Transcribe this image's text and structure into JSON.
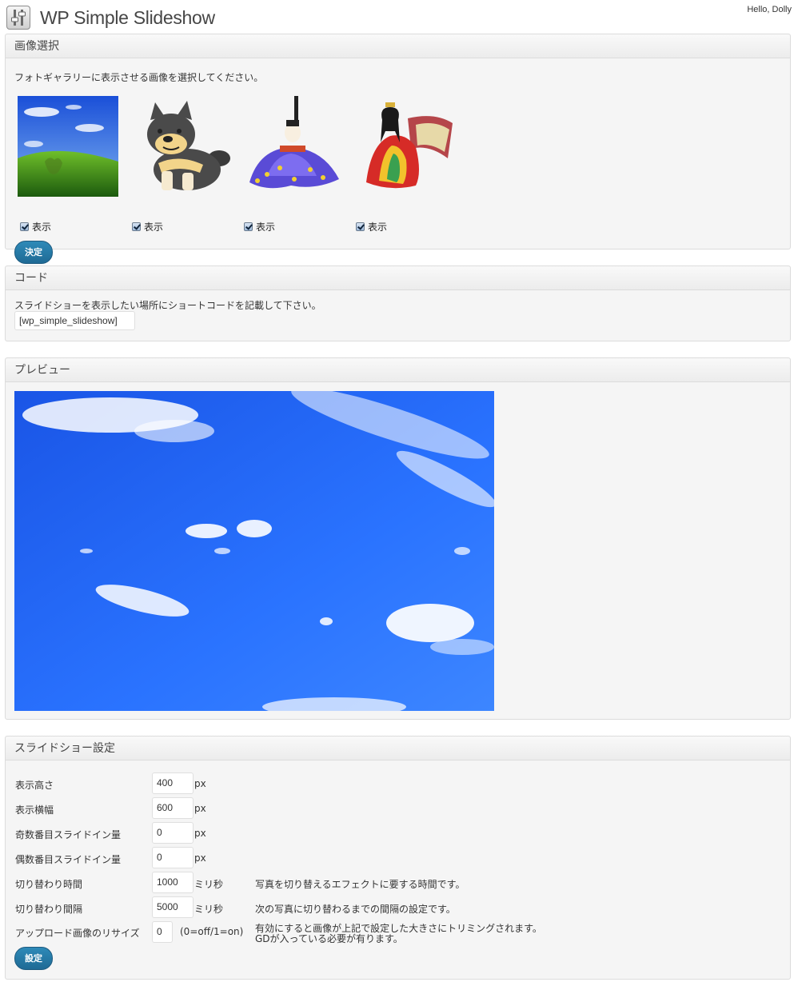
{
  "header": {
    "title": "WP Simple Slideshow",
    "greeting": "Hello, Dolly",
    "icon": "slideshow-plugin-icon"
  },
  "image_select": {
    "title": "画像選択",
    "description": "フォトギャラリーに表示させる画像を選択してください。",
    "items": [
      {
        "image": "windows-hill-wallpaper",
        "label": "表示",
        "checked": true
      },
      {
        "image": "shiba-dog-illustration",
        "label": "表示",
        "checked": true
      },
      {
        "image": "hina-doll-emperor",
        "label": "表示",
        "checked": true
      },
      {
        "image": "hina-doll-empress",
        "label": "表示",
        "checked": true
      }
    ],
    "submit_label": "決定"
  },
  "code": {
    "title": "コード",
    "description": "スライドショーを表示したい場所にショートコードを記載して下さい。",
    "shortcode": "[wp_simple_slideshow]"
  },
  "preview": {
    "title": "プレビュー",
    "image": "blue-sky-clouds"
  },
  "settings": {
    "title": "スライドショー設定",
    "rows": [
      {
        "label": "表示高さ",
        "value": "400",
        "unit": "px",
        "note": ""
      },
      {
        "label": "表示横幅",
        "value": "600",
        "unit": "px",
        "note": ""
      },
      {
        "label": "奇数番目スライドイン量",
        "value": "0",
        "unit": "px",
        "note": ""
      },
      {
        "label": "偶数番目スライドイン量",
        "value": "0",
        "unit": "px",
        "note": ""
      },
      {
        "label": "切り替わり時間",
        "value": "1000",
        "unit": "ミリ秒",
        "note": "写真を切り替えるエフェクトに要する時間です。"
      },
      {
        "label": "切り替わり間隔",
        "value": "5000",
        "unit": "ミリ秒",
        "note": "次の写真に切り替わるまでの間隔の設定です。"
      },
      {
        "label": "アップロード画像のリサイズ",
        "value": "0",
        "unit": "(0=off/1=on)",
        "note": "有効にすると画像が上記で設定した大きさにトリミングされます。",
        "note2": "GDが入っている必要が有ります。"
      }
    ],
    "submit_label": "設定"
  },
  "colors": {
    "primary_button": "#21759b",
    "panel_bg": "#f5f5f5",
    "border": "#dcdcdc"
  }
}
